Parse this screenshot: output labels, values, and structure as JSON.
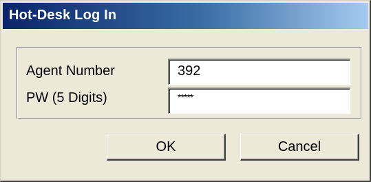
{
  "window": {
    "title": "Hot-Desk Log In"
  },
  "form": {
    "agent_number_label": "Agent Number",
    "agent_number_value": "392",
    "password_label": "PW (5 Digits)",
    "password_value": "*****"
  },
  "buttons": {
    "ok_label": "OK",
    "cancel_label": "Cancel"
  },
  "colors": {
    "titlebar_start": "#0a246a",
    "titlebar_end": "#a6caf0",
    "dialog_background": "#ece9d8"
  }
}
